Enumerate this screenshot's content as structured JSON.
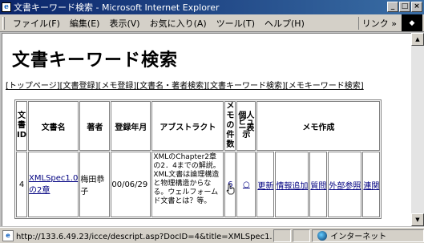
{
  "window": {
    "title": "文書キーワード検索 - Microsoft Internet Explorer",
    "controls": [
      "_",
      "□",
      "×"
    ]
  },
  "menubar": {
    "items": [
      "ファイル(F)",
      "編集(E)",
      "表示(V)",
      "お気に入り(A)",
      "ツール(T)",
      "ヘルプ(H)"
    ],
    "links_label": "リンク »"
  },
  "page": {
    "title": "文書キーワード検索",
    "nav_links": [
      "[トップページ]",
      "[文書登録]",
      "[メモ登録]",
      "[文書名・著者検索]",
      "[文書キーワード検索]",
      "[メモキーワード検索]"
    ]
  },
  "table": {
    "headers": {
      "id": [
        "文",
        "書",
        "ID"
      ],
      "doc_name": "文書名",
      "author": "著者",
      "reg_date": "登録年月",
      "abstract": "アブストラクト",
      "memo_count": [
        "メ",
        "モ",
        "の",
        "件",
        "数"
      ],
      "personal": "個人ビュー表示",
      "memo_create": "メモ作成"
    },
    "row": {
      "id": "4",
      "doc_name": "XMLSpec1.0の2章",
      "author": "梅田恭子",
      "reg_date": "00/06/29",
      "abstract": "XMLのChapter2章の2．4までの解説。XML文書は論理構造と物理構造からなる。ウェルフォームド文書とは？等。",
      "memo_count": "6",
      "personal_mark": "○",
      "actions": [
        "更新",
        "情報追加",
        "質問",
        "外部参照",
        "連関"
      ]
    }
  },
  "statusbar": {
    "url": "http://133.6.49.23/icce/descript.asp?DocID=4&title=XMLSpec1.0の2章",
    "zone": "インターネット"
  }
}
